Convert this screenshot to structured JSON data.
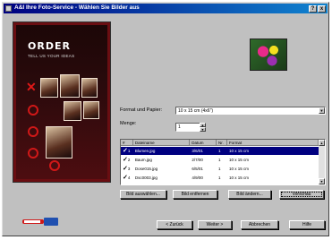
{
  "window": {
    "title": "A&I Ihre Foto-Service - Wählen Sie Bilder aus",
    "controls": {
      "help": "?",
      "close": "x"
    }
  },
  "poster": {
    "brand": "ORDER",
    "tagline": "TELL US YOUR IDEAS"
  },
  "form": {
    "format_label": "Format und Papier:",
    "format_value": "10 x 15 cm  (4x6\")",
    "quantity_label": "Menge:",
    "quantity_value": "1"
  },
  "table": {
    "columns": [
      "#",
      "Dateiname",
      "Datum",
      "Nr.",
      "Format"
    ],
    "rows": [
      {
        "num": "1",
        "name": "Blumen.jpg",
        "date": "3/6/01",
        "nr": "1",
        "format": "10 x 15 cm",
        "selected": true
      },
      {
        "num": "2",
        "name": "Baum.jpg",
        "date": "2/7/00",
        "nr": "1",
        "format": "10 x 15 cm",
        "selected": false
      },
      {
        "num": "3",
        "name": "Dose015.jpg",
        "date": "6/5/01",
        "nr": "1",
        "format": "10 x 15 cm",
        "selected": false
      },
      {
        "num": "4",
        "name": "Dsc0003.jpg",
        "date": "4/9/00",
        "nr": "1",
        "format": "10 x 15 cm",
        "selected": false
      }
    ]
  },
  "actions": {
    "add_images": "Bild auswählen...",
    "remove_images": "Bild entfernen",
    "edit_image": "Bild ändern...",
    "preview": "Vorschau"
  },
  "nav": {
    "back": "< Zurück",
    "next": "Weiter >",
    "cancel": "Abbrechen",
    "help": "Hilfe"
  },
  "colors": {
    "titlebar": "#000080",
    "face": "#c0c0c0",
    "selection": "#000080"
  }
}
